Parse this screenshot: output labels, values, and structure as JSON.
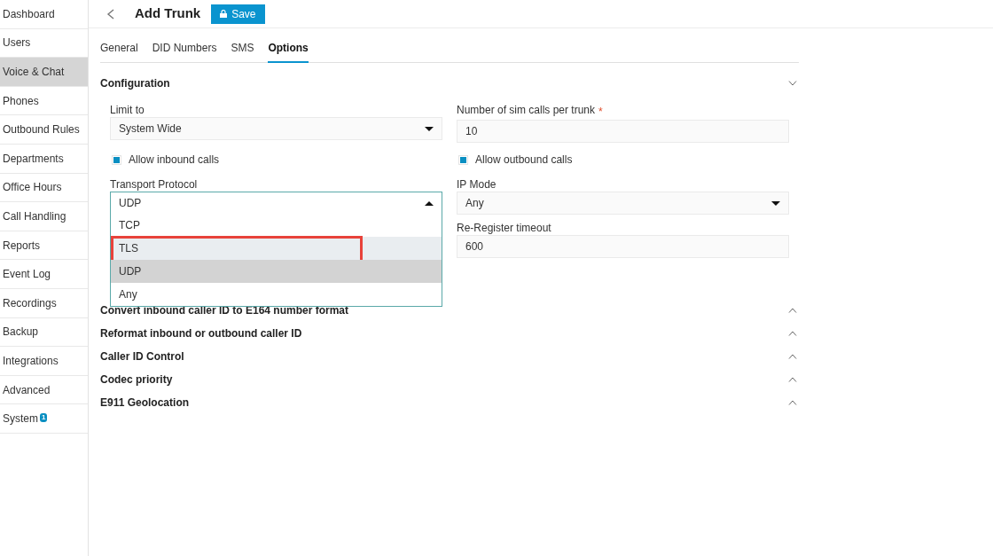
{
  "sidebar": {
    "items": [
      {
        "label": "Dashboard",
        "selected": false
      },
      {
        "label": "Users",
        "selected": false
      },
      {
        "label": "Voice & Chat",
        "selected": true
      },
      {
        "label": "Phones",
        "selected": false
      },
      {
        "label": "Outbound Rules",
        "selected": false
      },
      {
        "label": "Departments",
        "selected": false
      },
      {
        "label": "Office Hours",
        "selected": false
      },
      {
        "label": "Call Handling",
        "selected": false
      },
      {
        "label": "Reports",
        "selected": false
      },
      {
        "label": "Event Log",
        "selected": false
      },
      {
        "label": "Recordings",
        "selected": false
      },
      {
        "label": "Backup",
        "selected": false
      },
      {
        "label": "Integrations",
        "selected": false
      },
      {
        "label": "Advanced",
        "selected": false
      },
      {
        "label": "System",
        "selected": false,
        "badge": "1"
      }
    ]
  },
  "header": {
    "title": "Add Trunk",
    "save_button": "Save"
  },
  "tabs": [
    {
      "label": "General",
      "selected": false
    },
    {
      "label": "DID Numbers",
      "selected": false
    },
    {
      "label": "SMS",
      "selected": false
    },
    {
      "label": "Options",
      "selected": true
    }
  ],
  "sections": [
    {
      "title": "Configuration",
      "expanded": true,
      "fields": [
        {
          "kind": "select",
          "label": "Limit to",
          "value": "System Wide",
          "open": false
        },
        {
          "kind": "input",
          "label": "Number of sim calls per trunk",
          "required_mark": "*",
          "value": "10"
        },
        {
          "kind": "checkbox",
          "label": "Allow inbound calls",
          "checked": true
        },
        {
          "kind": "checkbox",
          "label": "Allow outbound calls",
          "checked": true
        },
        {
          "kind": "select",
          "label": "Transport Protocol",
          "value": "UDP",
          "open": true,
          "options": [
            {
              "label": "TCP",
              "selected": false,
              "highlighted": false
            },
            {
              "label": "TLS",
              "selected": false,
              "highlighted": true
            },
            {
              "label": "UDP",
              "selected": true,
              "highlighted": false
            },
            {
              "label": "Any",
              "selected": false,
              "highlighted": false
            }
          ]
        },
        {
          "kind": "select",
          "label": "IP Mode",
          "value": "Any",
          "open": false
        },
        {
          "kind": "empty"
        },
        {
          "kind": "input",
          "label": "Re-Register timeout",
          "value": "600"
        }
      ]
    },
    {
      "title": "Convert inbound caller ID to E164 number format",
      "expanded": false
    },
    {
      "title": "Reformat inbound or outbound caller ID",
      "expanded": false
    },
    {
      "title": "Caller ID Control",
      "expanded": false
    },
    {
      "title": "Codec priority",
      "expanded": false
    },
    {
      "title": "E911 Geolocation",
      "expanded": false
    }
  ]
}
